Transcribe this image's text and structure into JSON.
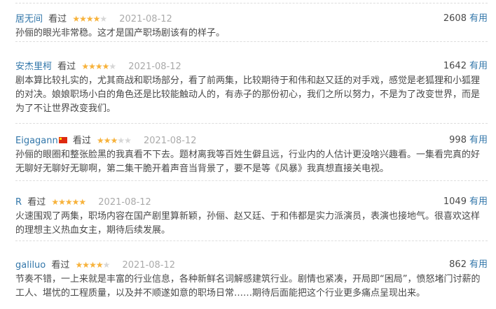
{
  "useful_label": "有用",
  "status_label": "看过",
  "reviews": [
    {
      "user": "居无间",
      "has_flag": false,
      "stars": 4,
      "date": "2021-08-12",
      "votes": "2608",
      "content": "孙俪的眼光非常稳。这才是国产职场剧该有的样子。"
    },
    {
      "user": "安杰里柯",
      "has_flag": false,
      "stars": 4,
      "date": "2021-08-12",
      "votes": "1642",
      "content": "剧本算比较扎实的，尤其商战和职场部分，看了前两集，比较期待于和伟和赵又廷的对手戏，感觉是老狐狸和小狐狸的对决。娘娘职场小白的角色还是比较能触动人的，有赤子的那份初心，我们之所以努力，不是为了改变世界，而是为了不让世界改变我们。"
    },
    {
      "user": "Eigagann",
      "has_flag": true,
      "stars": 3,
      "date": "2021-08-12",
      "votes": "998",
      "content": "孙俪的眼圈和整张脸黑的我真看不下去。题材离我等百姓生僻且远，行业内的人估计更没啥兴趣看。一集看完真的好无聊好无聊好无聊啊，第二集干脆开着声音当背景了，要不是等《风暴》我真想直接关电视。"
    },
    {
      "user": "R",
      "has_flag": false,
      "stars": 5,
      "date": "2021-08-12",
      "votes": "1049",
      "content": "火速围观了两集，职场内容在国产剧里算新颖，孙俪、赵又廷、于和伟都是实力派演员，表演也接地气。很喜欢这样的理想主义热血女主，期待后续发展。"
    },
    {
      "user": "galiluo",
      "has_flag": false,
      "stars": 4,
      "date": "2021-08-12",
      "votes": "862",
      "content": "节奏不错，一上来就是丰富的行业信息，各种新鲜名词解感建筑行业。剧情也紧凑，开局即“困局”，愤怒堵门讨薪的工人、堪忧的工程质量，以及并不顺遂如意的职场日常……期待后面能把这个行业更多痛点呈现出来。"
    }
  ]
}
